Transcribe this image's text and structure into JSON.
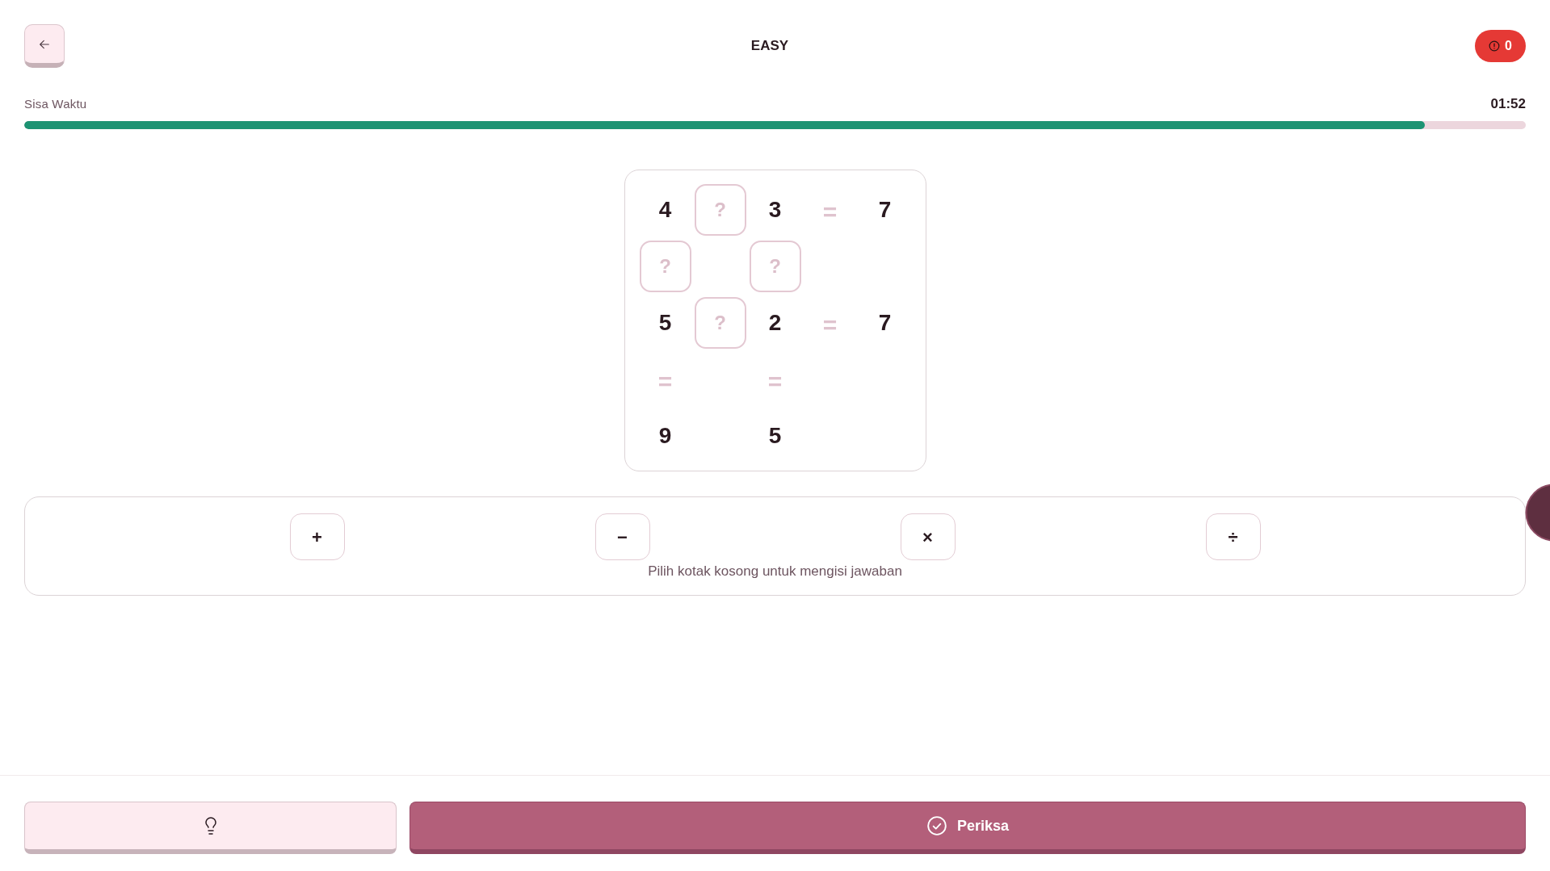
{
  "header": {
    "title": "EASY",
    "error_badge": {
      "count": "0"
    }
  },
  "timer": {
    "label": "Sisa Waktu",
    "time": "01:52",
    "level": 0.933
  },
  "puzzle": {
    "rows": [
      [
        {
          "kind": "number",
          "text": "4"
        },
        {
          "kind": "blank",
          "placeholder": "?"
        },
        {
          "kind": "number",
          "text": "3"
        },
        {
          "kind": "equals",
          "text": "="
        },
        {
          "kind": "number",
          "text": "7"
        }
      ],
      [
        {
          "kind": "blank",
          "placeholder": "?"
        },
        {
          "kind": "empty"
        },
        {
          "kind": "blank",
          "placeholder": "?"
        }
      ],
      [
        {
          "kind": "number",
          "text": "5"
        },
        {
          "kind": "blank",
          "placeholder": "?"
        },
        {
          "kind": "number",
          "text": "2"
        },
        {
          "kind": "equals",
          "text": "="
        },
        {
          "kind": "number",
          "text": "7"
        }
      ],
      [
        {
          "kind": "equals",
          "text": "="
        },
        {
          "kind": "empty"
        },
        {
          "kind": "equals",
          "text": "="
        }
      ],
      [
        {
          "kind": "number",
          "text": "9"
        },
        {
          "kind": "empty"
        },
        {
          "kind": "number",
          "text": "5"
        }
      ]
    ]
  },
  "operators": {
    "buttons": [
      "+",
      "−",
      "×",
      "÷"
    ],
    "instruction": "Pilih kotak kosong untuk mengisi jawaban"
  },
  "footer": {
    "check_button": {
      "label": "Periksa"
    }
  }
}
